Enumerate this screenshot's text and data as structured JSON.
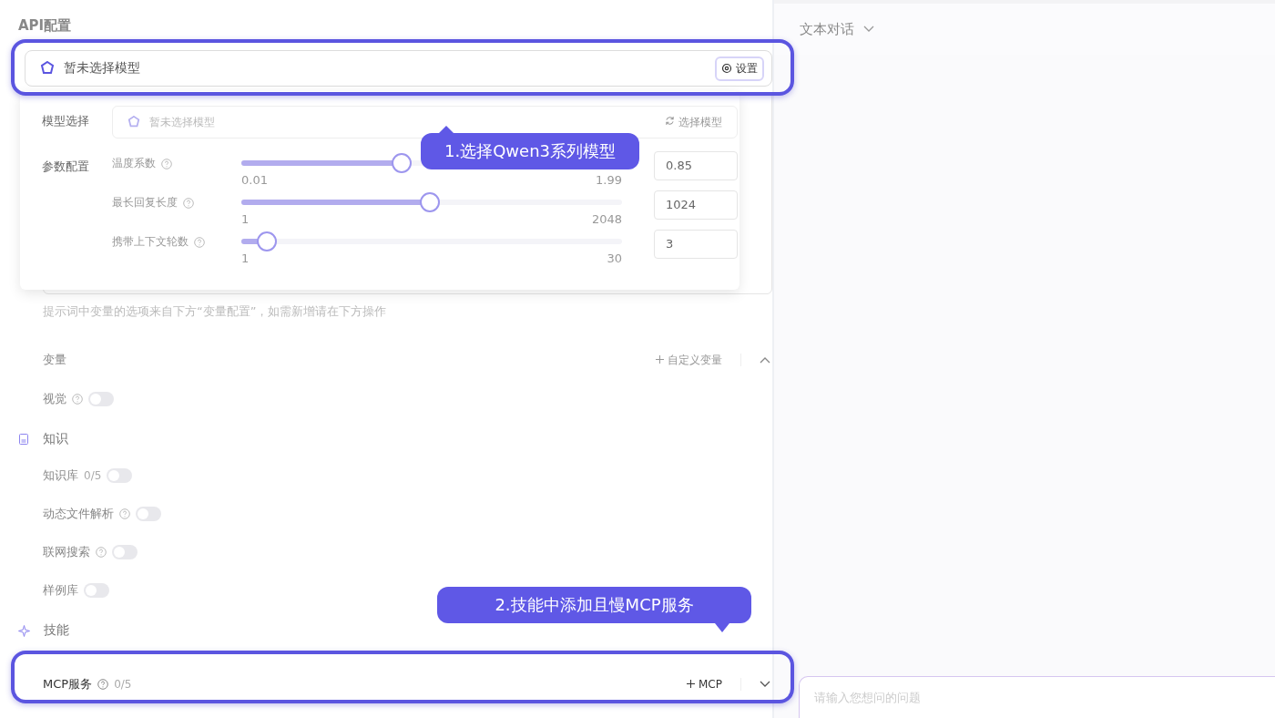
{
  "left_panel": {
    "title": "API配置",
    "model_field": {
      "value": "暂未选择模型",
      "settings_button": "设置"
    },
    "model_popover": {
      "model_label": "模型选择",
      "model_field": {
        "placeholder": "暂未选择模型",
        "button": "选择模型"
      },
      "params_label": "参数配置",
      "params": [
        {
          "label": "温度系数",
          "level": 0.42,
          "value": "0.85",
          "min": "0.01",
          "max": "1.99"
        },
        {
          "label": "最长回复长度",
          "level": 0.495,
          "value": "1024",
          "min": "1",
          "max": "2048"
        },
        {
          "label": "携带上下文轮数",
          "level": 0.067,
          "value": "3",
          "min": "1",
          "max": "30"
        }
      ]
    },
    "prompt_hint": "提示词中变量的选项来自下方“变量配置”，如需新增请在下方操作",
    "variables": {
      "title": "变量",
      "add_button": "自定义变量",
      "expanded": true
    },
    "vision": {
      "label": "视觉",
      "help": true,
      "on": false
    },
    "knowledge": {
      "title": "知识",
      "items": [
        {
          "label": "知识库",
          "count": "0/5",
          "help": false,
          "on": false
        },
        {
          "label": "动态文件解析",
          "help": true,
          "on": false
        },
        {
          "label": "联网搜索",
          "help": true,
          "on": false
        },
        {
          "label": "样例库",
          "help": false,
          "on": false
        }
      ]
    },
    "skills": {
      "title": "技能",
      "mcp": {
        "label": "MCP服务",
        "count": "0/5",
        "add_button": "MCP",
        "expanded": false
      }
    }
  },
  "right_panel": {
    "mode_select": "文本对话",
    "chat_input": {
      "placeholder": "请输入您想问的问题"
    }
  },
  "callouts": [
    {
      "text": "1.选择Qwen3系列模型"
    },
    {
      "text": "2.技能中添加且慢MCP服务"
    }
  ]
}
